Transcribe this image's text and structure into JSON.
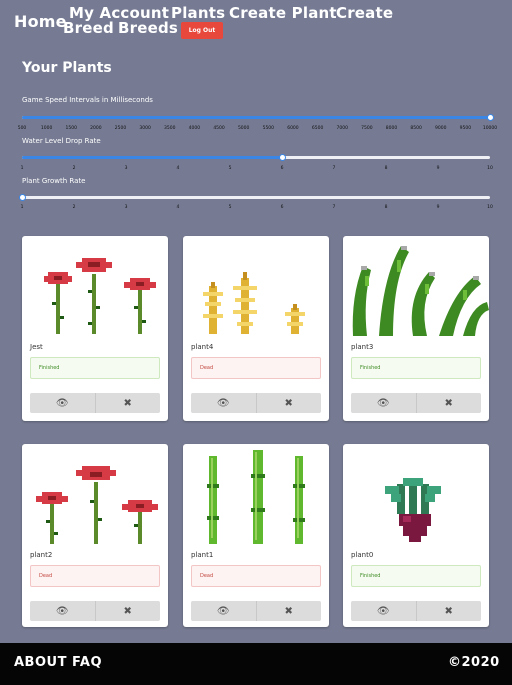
{
  "nav": {
    "home": "Home",
    "my_account": "My Account",
    "plants": "Plants",
    "create_plant": "Create Plant",
    "create_breed_1": "Create",
    "create_breed_2": "Breed",
    "breeds": "Breeds",
    "logout": "Log Out"
  },
  "page": {
    "title": "Your Plants"
  },
  "sliders": [
    {
      "label": "Game Speed Intervals in Milliseconds",
      "value": 10000,
      "min": 500,
      "max": 10000,
      "ticks": [
        "500",
        "1000",
        "1500",
        "2000",
        "2500",
        "3000",
        "3500",
        "4000",
        "4500",
        "5000",
        "5500",
        "6000",
        "6500",
        "7000",
        "7500",
        "8000",
        "8500",
        "9000",
        "9500",
        "10000"
      ]
    },
    {
      "label": "Water Level Drop Rate",
      "value": 6,
      "min": 1,
      "max": 10,
      "ticks": [
        "1",
        "2",
        "3",
        "4",
        "5",
        "6",
        "7",
        "8",
        "9",
        "10"
      ]
    },
    {
      "label": "Plant Growth Rate",
      "value": 1,
      "min": 1,
      "max": 10,
      "ticks": [
        "1",
        "2",
        "3",
        "4",
        "5",
        "6",
        "7",
        "8",
        "9",
        "10"
      ]
    }
  ],
  "plants": [
    {
      "name": "Jest",
      "status": "Finished",
      "kind": "flowers"
    },
    {
      "name": "plant4",
      "status": "Dead",
      "kind": "wheat"
    },
    {
      "name": "plant3",
      "status": "Finished",
      "kind": "vines"
    },
    {
      "name": "plant2",
      "status": "Dead",
      "kind": "flowers"
    },
    {
      "name": "plant1",
      "status": "Dead",
      "kind": "bamboo"
    },
    {
      "name": "plant0",
      "status": "Finished",
      "kind": "beet"
    }
  ],
  "footer": {
    "about": "ABOUT",
    "faq": "FAQ",
    "copyright": "©2020"
  },
  "colors": {
    "accent": "#3a86e6",
    "logout": "#e8483b",
    "background": "#767b93",
    "footer": "#050505"
  }
}
